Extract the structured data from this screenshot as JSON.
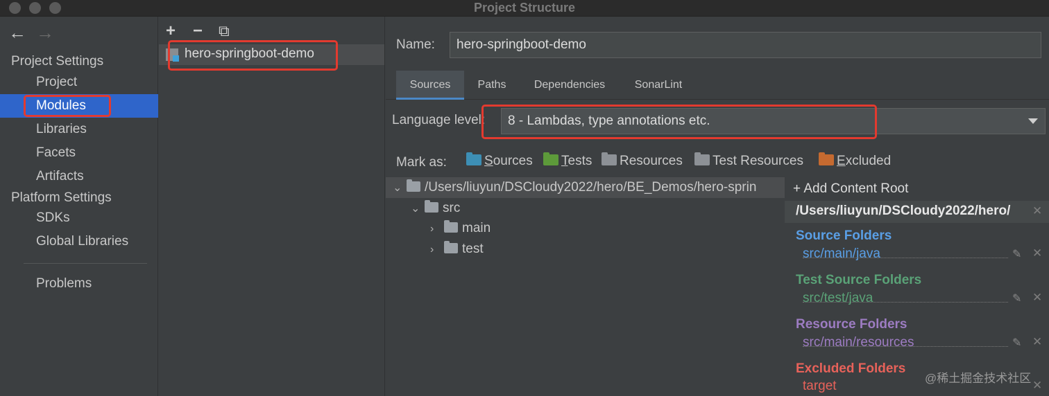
{
  "window": {
    "title": "Project Structure"
  },
  "nav": {
    "back": "←",
    "forward": "→",
    "project_settings": "Project Settings",
    "items_project": [
      "Project",
      "Modules",
      "Libraries",
      "Facets",
      "Artifacts"
    ],
    "platform_settings": "Platform Settings",
    "items_platform": [
      "SDKs",
      "Global Libraries"
    ],
    "problems": "Problems",
    "selected": "Modules"
  },
  "modules": {
    "toolbar": {
      "add": "+",
      "remove": "−",
      "copy": "⧉"
    },
    "list": [
      "hero-springboot-demo"
    ]
  },
  "module": {
    "name_label": "Name:",
    "name_value": "hero-springboot-demo",
    "tabs": [
      "Sources",
      "Paths",
      "Dependencies",
      "SonarLint"
    ],
    "active_tab": "Sources",
    "language_level_label": "Language level:",
    "language_level_value": "8 - Lambdas, type annotations etc.",
    "mark_as_label": "Mark as:",
    "mark_as": [
      {
        "label": "Sources",
        "color": "#3d8fb5"
      },
      {
        "label": "Tests",
        "color": "#5d9a3a"
      },
      {
        "label": "Resources",
        "color": "#8d9196"
      },
      {
        "label": "Test Resources",
        "color": "#8d9196"
      },
      {
        "label": "Excluded",
        "color": "#c56a30"
      }
    ]
  },
  "tree": {
    "root": "/Users/liuyun/DSCloudy2022/hero/BE_Demos/hero-sprin",
    "src": "src",
    "main": "main",
    "test": "test"
  },
  "content_root": {
    "add_label": "Add Content Root",
    "path": "/Users/liuyun/DSCloudy2022/hero/",
    "groups": [
      {
        "title": "Source Folders",
        "path": "src/main/java",
        "color": "#5a9fe6"
      },
      {
        "title": "Test Source Folders",
        "path": "src/test/java",
        "color": "#5aa277"
      },
      {
        "title": "Resource Folders",
        "path": "src/main/resources",
        "color": "#9d7cc2"
      },
      {
        "title": "Excluded Folders",
        "path": "target",
        "color": "#e8625a"
      }
    ]
  },
  "watermark": "@稀土掘金技术社区"
}
